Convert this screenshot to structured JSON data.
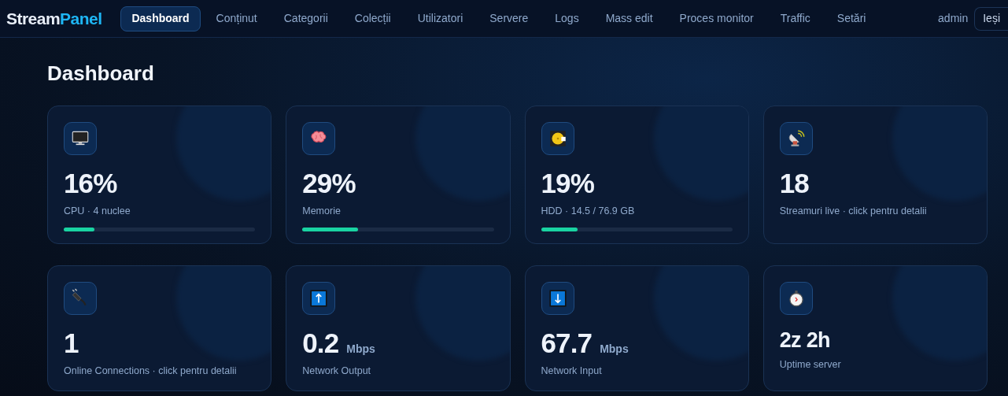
{
  "brand": {
    "first": "Stream",
    "second": "Panel"
  },
  "nav": [
    {
      "label": "Dashboard",
      "selected": true
    },
    {
      "label": "Conținut",
      "selected": false
    },
    {
      "label": "Categorii",
      "selected": false
    },
    {
      "label": "Colecții",
      "selected": false
    },
    {
      "label": "Utilizatori",
      "selected": false
    },
    {
      "label": "Servere",
      "selected": false
    },
    {
      "label": "Logs",
      "selected": false
    },
    {
      "label": "Mass edit",
      "selected": false
    },
    {
      "label": "Proces monitor",
      "selected": false
    },
    {
      "label": "Traffic",
      "selected": false
    },
    {
      "label": "Setări",
      "selected": false
    }
  ],
  "user": {
    "name": "admin",
    "logout": "Ieși"
  },
  "heading": "Dashboard",
  "cards": [
    {
      "kind": "large",
      "value": "16%",
      "label": "CPU · 4 nuclee",
      "level": 0.16
    },
    {
      "kind": "large",
      "value": "29%",
      "label": "Memorie",
      "level": 0.29
    },
    {
      "kind": "large",
      "value": "19%",
      "label": "HDD · 14.5 / 76.9 GB",
      "level": 0.19
    },
    {
      "kind": "large",
      "value": "18",
      "label": "Streamuri live · click pentru detalii"
    },
    {
      "kind": "large",
      "value": "1",
      "label": "Online Connections · click pentru detalii"
    },
    {
      "kind": "large",
      "value": "0.2",
      "unit": "Mbps",
      "label": "Network Output"
    },
    {
      "kind": "large",
      "value": "67.7",
      "unit": "Mbps",
      "label": "Network Input"
    },
    {
      "kind": "small",
      "value": "2z 2h",
      "label": "Uptime server"
    }
  ]
}
